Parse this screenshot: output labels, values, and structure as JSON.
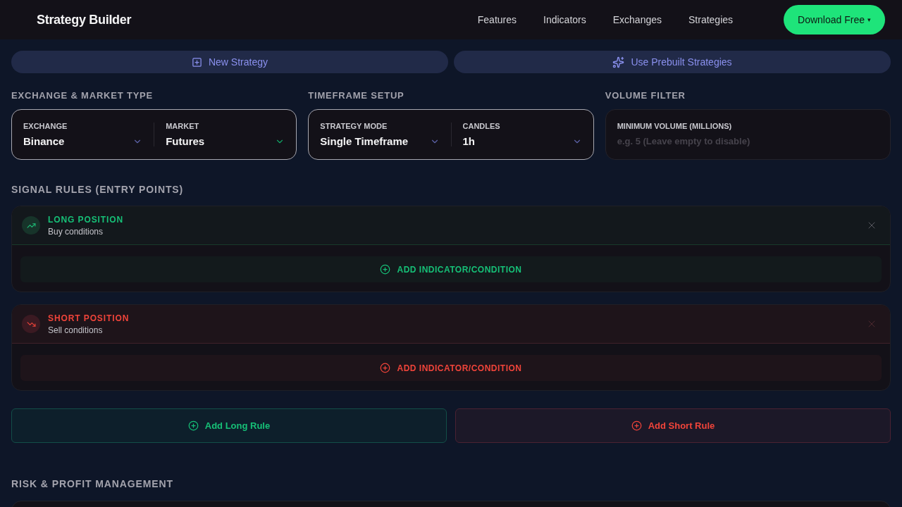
{
  "nav": {
    "brand": "Strategy Builder",
    "links": [
      "Features",
      "Indicators",
      "Exchanges",
      "Strategies"
    ],
    "cta": {
      "label": "Download Free",
      "caret": "▾"
    }
  },
  "actions": [
    {
      "kind": "create",
      "label": "New Strategy"
    },
    {
      "kind": "prebuilt",
      "label": "Use Prebuilt Strategies"
    }
  ],
  "settings": [
    {
      "kind": "select",
      "title": "EXCHANGE & MARKET TYPE",
      "fields": [
        {
          "label": "EXCHANGE",
          "value": "Binance",
          "color": "#5c63a8"
        },
        {
          "label": "MARKET",
          "value": "Futures",
          "color": "#12a466"
        }
      ]
    },
    {
      "kind": "select",
      "title": "TIMEFRAME SETUP",
      "fields": [
        {
          "label": "STRATEGY MODE",
          "value": "Single Timeframe",
          "color": "#5c63a8"
        },
        {
          "label": "CANDLES",
          "value": "1h",
          "color": "#5c63a8"
        }
      ]
    },
    {
      "kind": "input",
      "title": "VOLUME FILTER",
      "fields": [
        {
          "label": "MINIMUM VOLUME (MILLIONS)",
          "placeholder": "e.g. 5 (Leave empty to disable)"
        }
      ]
    }
  ],
  "signal_rules": {
    "title": "SIGNAL RULES (ENTRY POINTS)",
    "rules": [
      {
        "kind": "long",
        "title": "LONG POSITION",
        "subtitle": "Buy conditions",
        "add_label": "ADD INDICATOR/CONDITION"
      },
      {
        "kind": "short",
        "title": "SHORT POSITION",
        "subtitle": "Sell conditions",
        "add_label": "ADD INDICATOR/CONDITION"
      }
    ]
  },
  "rule_buttons": [
    {
      "kind": "long",
      "label": "Add Long Rule"
    },
    {
      "kind": "short",
      "label": "Add Short Rule"
    }
  ],
  "risk": {
    "title": "RISK & PROFIT MANAGEMENT"
  }
}
